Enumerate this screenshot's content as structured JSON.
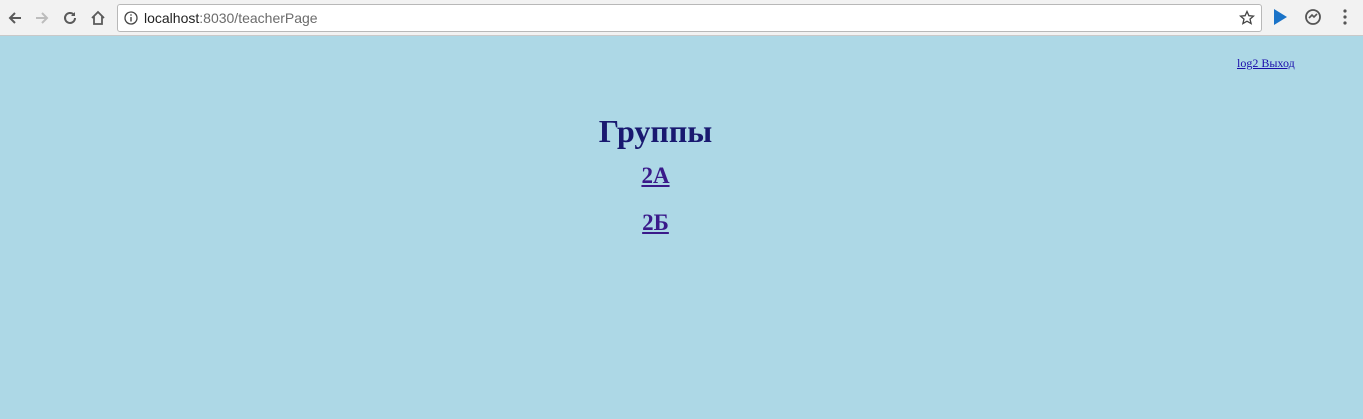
{
  "browser": {
    "url_host": "localhost",
    "url_rest": ":8030/teacherPage"
  },
  "header": {
    "user_link": "log2 Выход"
  },
  "main": {
    "title": "Группы",
    "groups": [
      {
        "label": "2А"
      },
      {
        "label": "2Б"
      }
    ]
  },
  "colors": {
    "page_background": "#add8e6",
    "title": "#191970",
    "link": "#3a1a8a"
  }
}
